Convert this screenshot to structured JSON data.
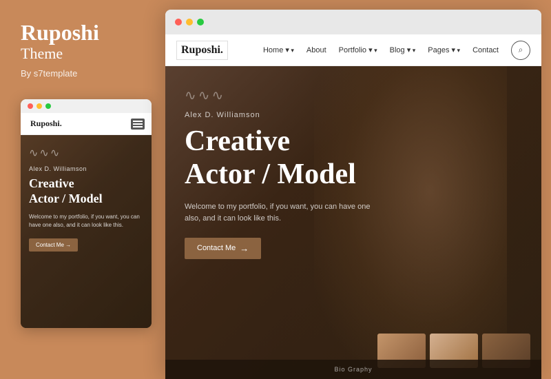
{
  "left": {
    "title": "Ruposhi",
    "subtitle": "Theme",
    "author": "By s7template"
  },
  "mobile": {
    "browser_dots": [
      "red",
      "yellow",
      "green"
    ],
    "logo": "Ruposhi.",
    "wave": "~~~",
    "hero_name": "Alex D. Williamson",
    "hero_title_line1": "Creative",
    "hero_title_line2": "Actor / Model",
    "hero_desc": "Welcome to my portfolio, if you want, you can have one also, and it can look like this.",
    "cta_label": "Contact Me"
  },
  "desktop": {
    "browser_dots": [
      "red",
      "yellow",
      "green"
    ],
    "logo": "Ruposhi.",
    "nav": {
      "links": [
        {
          "label": "Home",
          "has_arrow": true
        },
        {
          "label": "About",
          "has_arrow": false
        },
        {
          "label": "Portfolio",
          "has_arrow": true
        },
        {
          "label": "Blog",
          "has_arrow": true
        },
        {
          "label": "Pages",
          "has_arrow": true
        },
        {
          "label": "Contact",
          "has_arrow": false
        }
      ],
      "search_icon": "🔍"
    },
    "hero": {
      "wave": "∿∿∿",
      "name": "Alex D. Williamson",
      "title_line1": "Creative",
      "title_line2": "Actor / Model",
      "description": "Welcome to my portfolio, if you want, you can have one also, and it can look like this.",
      "cta_label": "Contact Me",
      "cta_arrow": "→"
    },
    "footer": {
      "text": "Bio Graphy"
    }
  }
}
